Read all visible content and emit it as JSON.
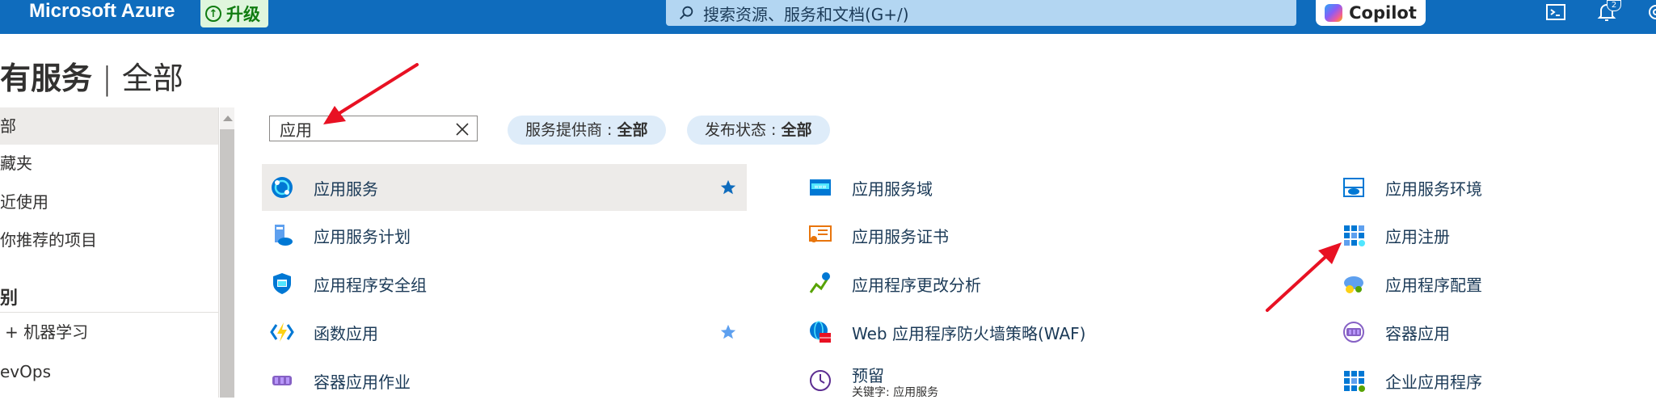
{
  "topbar": {
    "brand": "Microsoft Azure",
    "upgrade_label": "升级",
    "search_placeholder": "搜索资源、服务和文档(G+/)",
    "copilot_label": "Copilot",
    "notification_count": "2"
  },
  "page": {
    "title": "有服务",
    "separator": "|",
    "subtitle": "全部"
  },
  "sidebar": {
    "items": [
      {
        "label": "部",
        "selected": true
      },
      {
        "label": "藏夹"
      },
      {
        "label": "近使用"
      },
      {
        "label": "你推荐的项目"
      }
    ],
    "category_heading": "别",
    "category_items": [
      {
        "label": "+ 机器学习"
      },
      {
        "label": "evOps"
      }
    ]
  },
  "filters": {
    "search_value": "应用",
    "provider_label": "服务提供商 : ",
    "provider_value": "全部",
    "status_label": "发布状态 : ",
    "status_value": "全部"
  },
  "services": {
    "col1": [
      {
        "name": "应用服务",
        "icon": "app-service-icon",
        "favorite": true,
        "selected": true
      },
      {
        "name": "应用服务计划",
        "icon": "app-service-plan-icon"
      },
      {
        "name": "应用程序安全组",
        "icon": "app-security-group-icon"
      },
      {
        "name": "函数应用",
        "icon": "function-app-icon",
        "favorite": true
      },
      {
        "name": "容器应用作业",
        "icon": "container-app-job-icon"
      }
    ],
    "col2": [
      {
        "name": "应用服务域",
        "icon": "app-service-domain-icon"
      },
      {
        "name": "应用服务证书",
        "icon": "app-service-certificate-icon"
      },
      {
        "name": "应用程序更改分析",
        "icon": "change-analysis-icon"
      },
      {
        "name": "Web 应用程序防火墙策略(WAF)",
        "icon": "waf-policy-icon"
      },
      {
        "name": "预留",
        "icon": "reservation-icon",
        "keyword": "关键字: 应用服务"
      }
    ],
    "col3": [
      {
        "name": "应用服务环境",
        "icon": "app-service-environment-icon"
      },
      {
        "name": "应用注册",
        "icon": "app-registration-icon"
      },
      {
        "name": "应用程序配置",
        "icon": "app-configuration-icon"
      },
      {
        "name": "容器应用",
        "icon": "container-app-icon"
      },
      {
        "name": "企业应用程序",
        "icon": "enterprise-app-icon"
      }
    ]
  },
  "colors": {
    "topbar": "#0f6cbd",
    "accent": "#0078d4",
    "annotation_arrow": "#e81123"
  }
}
